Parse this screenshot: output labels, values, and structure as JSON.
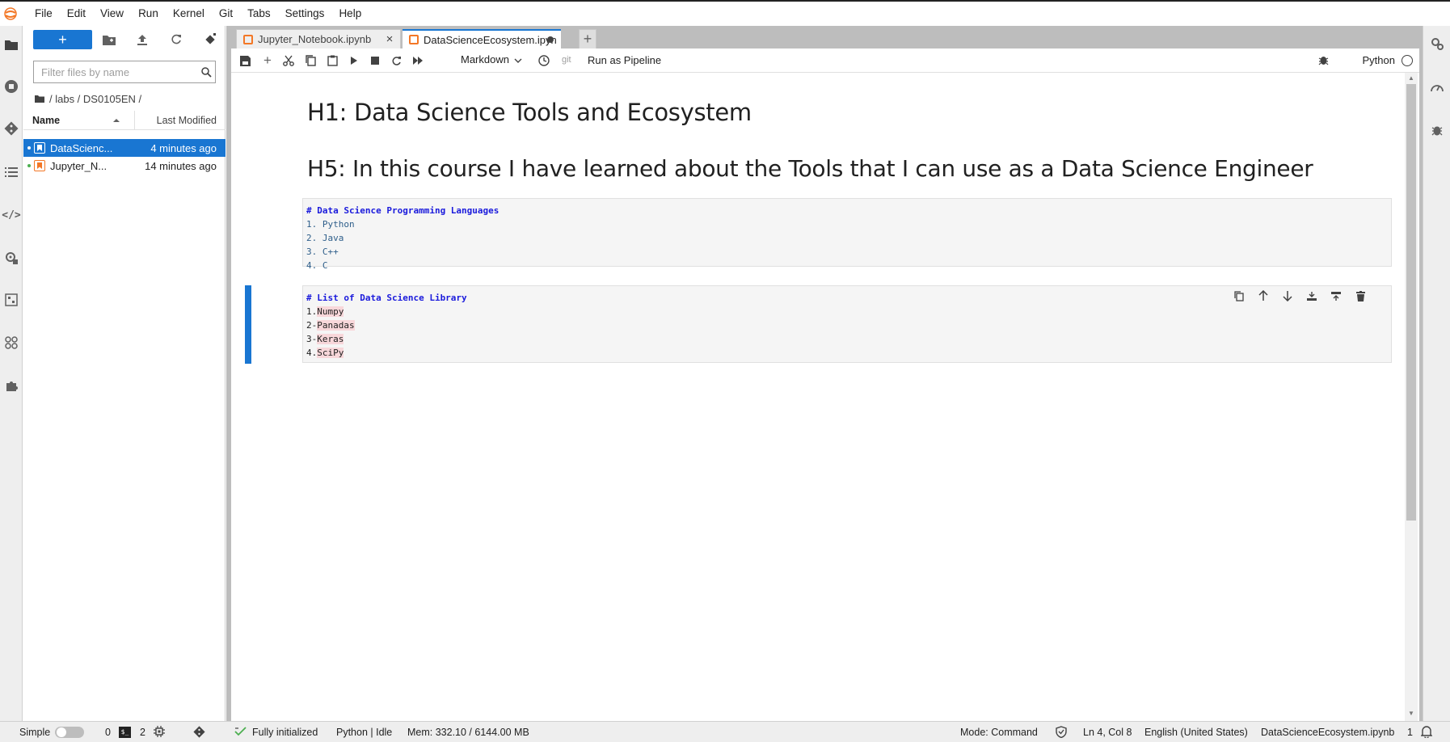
{
  "menu": {
    "items": [
      "File",
      "Edit",
      "View",
      "Run",
      "Kernel",
      "Git",
      "Tabs",
      "Settings",
      "Help"
    ]
  },
  "file_browser": {
    "new_label": "+",
    "filter_placeholder": "Filter files by name",
    "breadcrumb": "/ labs / DS0105EN /",
    "col_name": "Name",
    "col_modified": "Last Modified",
    "files": [
      {
        "name": "DataScienc...",
        "modified": "4 minutes ago",
        "selected": true
      },
      {
        "name": "Jupyter_N...",
        "modified": "14 minutes ago",
        "selected": false
      }
    ]
  },
  "tabs": [
    {
      "label": "Jupyter_Notebook.ipynb",
      "active": false
    },
    {
      "label": "DataScienceEcosystem.ipyn",
      "active": true
    }
  ],
  "add_tab": "+",
  "toolbar": {
    "cell_type": "Markdown",
    "git": "git",
    "pipeline": "Run as Pipeline",
    "kernel": "Python"
  },
  "cells": {
    "h1": "H1: Data Science Tools and Ecosystem",
    "h5": "H5: In this course I have learned about the Tools that I can use as a Data Science Engineer",
    "languages": {
      "heading": "# Data Science Programming Languages",
      "items": [
        "1. Python",
        "2. Java",
        "3. C++",
        "4. C"
      ]
    },
    "libraries": {
      "heading": "# List of Data Science Library",
      "prefixes": [
        "1.",
        "2-",
        "3-",
        "4."
      ],
      "items": [
        "Numpy",
        "Panadas",
        "Keras",
        "SciPy"
      ]
    }
  },
  "status": {
    "mode_simple": "Simple",
    "count_a": "0",
    "count_b": "2",
    "initialized": "Fully initialized",
    "kernel_state": "Python | Idle",
    "memory": "Mem: 332.10 / 6144.00 MB",
    "mode": "Mode: Command",
    "position": "Ln 4, Col 8",
    "language": "English (United States)",
    "filename": "DataScienceEcosystem.ipynb",
    "notifications": "1"
  },
  "colors": {
    "accent": "#1976d2",
    "notebook_orange": "#f37726"
  }
}
